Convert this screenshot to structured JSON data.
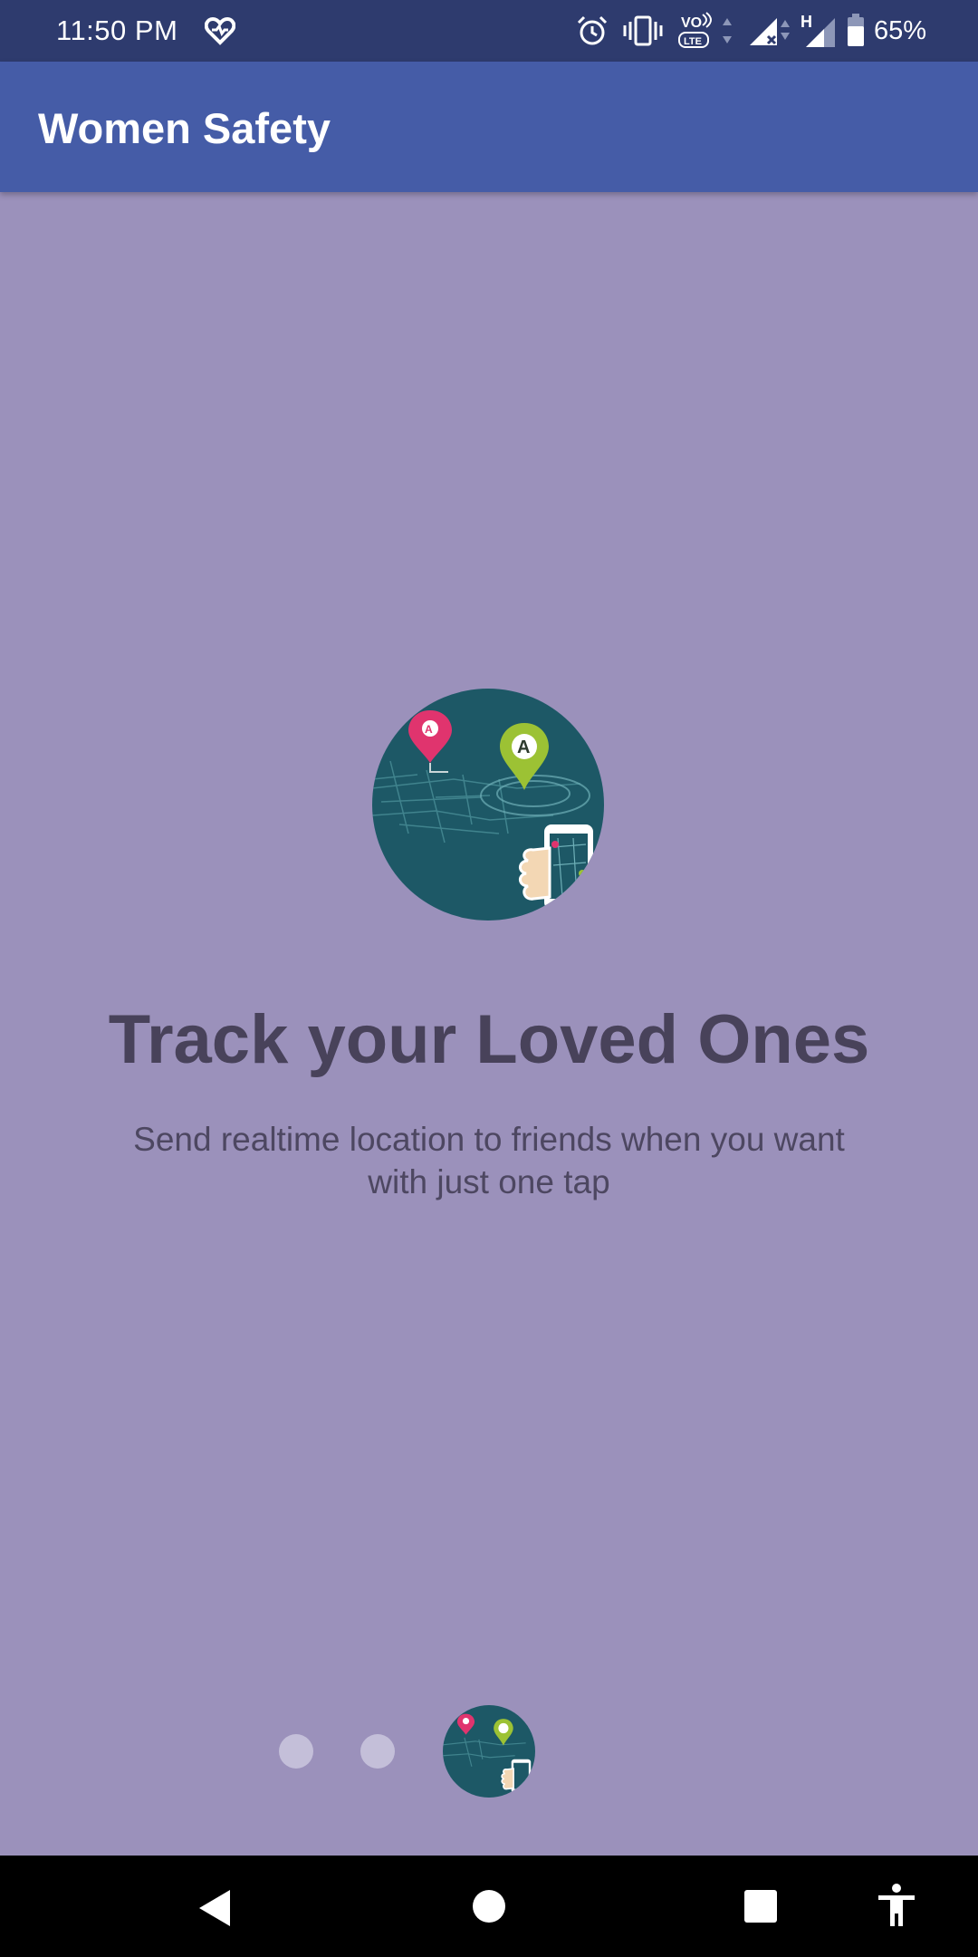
{
  "status_bar": {
    "time": "11:50 PM",
    "battery_percent": "65%",
    "icons": [
      "heart-monitor-icon",
      "alarm-icon",
      "vibrate-icon",
      "volte-icon",
      "signal-icon",
      "signal-h-icon",
      "battery-icon"
    ]
  },
  "app_bar": {
    "title": "Women Safety"
  },
  "slide": {
    "image": "track-location-illustration",
    "title": "Track your Loved Ones",
    "description_line1": "Send realtime location to friends when you want",
    "description_line2": "with just one tap"
  },
  "pager": {
    "total": 3,
    "active_index": 3
  },
  "nav_bar": {
    "buttons": [
      "back",
      "home",
      "recents",
      "accessibility"
    ]
  },
  "colors": {
    "status_bar": "#2e3b6e",
    "app_bar": "#455ca7",
    "background": "#9b91bb",
    "title_text": "#48425a",
    "illustration_bg": "#1d5866",
    "pin_pink": "#e0346e",
    "pin_green": "#9cc234"
  }
}
